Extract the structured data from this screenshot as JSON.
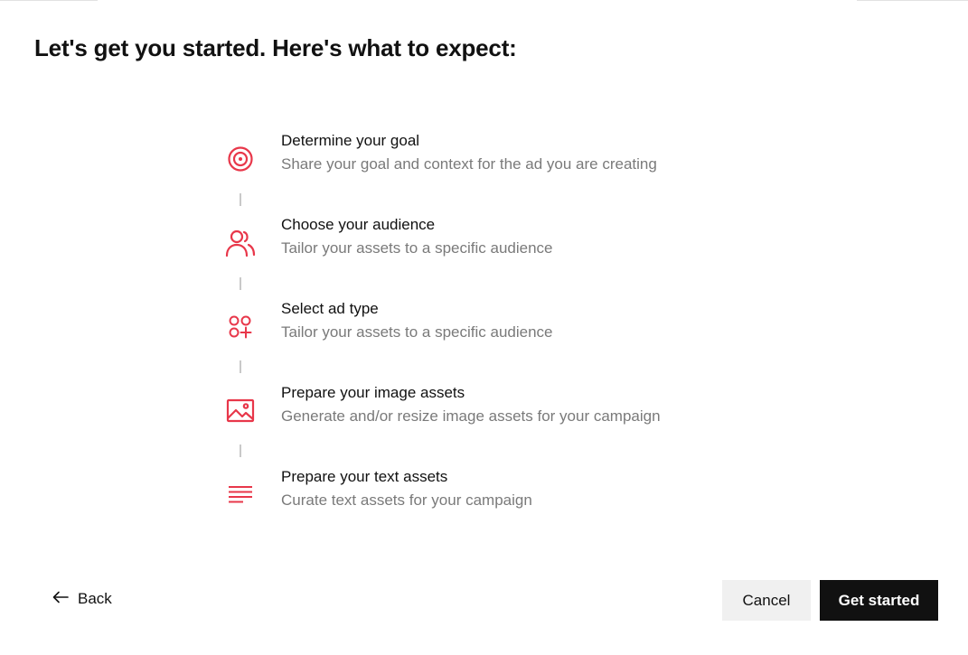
{
  "page": {
    "title": "Let's get you started. Here's what to expect:"
  },
  "colors": {
    "accent": "#e8374a",
    "primary_button_bg": "#111111",
    "secondary_button_bg": "#f0f0f0",
    "muted_text": "#7a7a7a",
    "connector": "#c9c9c9"
  },
  "steps": [
    {
      "icon": "target-icon",
      "title": "Determine your goal",
      "description": "Share your goal and context for the ad you are creating"
    },
    {
      "icon": "users-icon",
      "title": "Choose your audience",
      "description": "Tailor your assets to a specific audience"
    },
    {
      "icon": "ad-type-icon",
      "title": "Select ad type",
      "description": "Tailor your assets to a specific audience"
    },
    {
      "icon": "image-icon",
      "title": "Prepare your image assets",
      "description": "Generate and/or resize image assets for your campaign"
    },
    {
      "icon": "text-lines-icon",
      "title": "Prepare your text assets",
      "description": "Curate text assets for your campaign"
    }
  ],
  "footer": {
    "back_label": "Back",
    "back_icon": "arrow-left-icon",
    "cancel_label": "Cancel",
    "primary_label": "Get started"
  }
}
